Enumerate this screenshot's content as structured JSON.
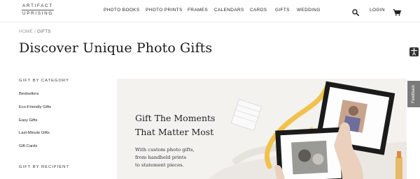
{
  "logo": {
    "line1": "ARTIFACT",
    "line2": "UPRISING"
  },
  "nav": {
    "items": [
      "PHOTO BOOKS",
      "PHOTO PRINTS",
      "FRAMES",
      "CALENDARS",
      "CARDS",
      "GIFTS",
      "WEDDING"
    ],
    "login": "LOGIN",
    "icons": [
      "search-icon",
      "cart-icon"
    ]
  },
  "breadcrumb": {
    "home": "HOME",
    "separator": "/",
    "current": "GIFTS"
  },
  "page": {
    "title": "Discover Unique Photo Gifts"
  },
  "sidebar": {
    "category_heading": "GIFT BY CATEGORY",
    "categories": [
      "Bestsellers",
      "Eco-Friendly Gifts",
      "Easy Gifts",
      "Last-Minute Gifts",
      "Gift Cards"
    ],
    "recipient_heading": "GIFT BY RECIPIENT"
  },
  "hero": {
    "title_line1": "Gift The Moments",
    "title_line2": "That Matter Most",
    "body_line1": "With custom photo gifts,",
    "body_line2": "from handheld prints",
    "body_line3": "to statement pieces."
  },
  "feedback": {
    "label": "Feedback"
  },
  "colors": {
    "feedback_tab": "#7a7a7a",
    "accessibility_button": "#333333",
    "hero_background": "#f4f2ef",
    "ribbon": "#f0c24a"
  }
}
